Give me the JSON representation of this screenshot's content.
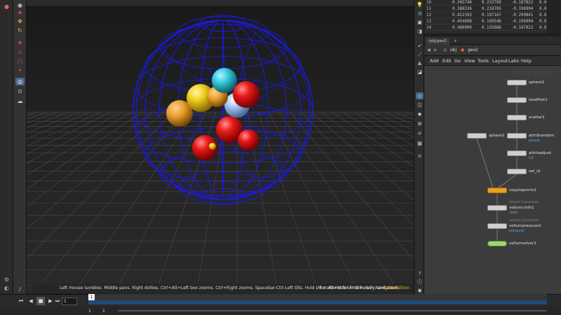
{
  "viewport": {
    "hint_text": "Left mouse tumbles. Middle pans. Right dollies. Ctrl+Alt+Left box zooms. Ctrl+Right zooms. Spacebar-Ctrl-Left tilts. Hold L for alternate tumble, dolly, and zoom.",
    "hint_text_2": "M or Alt+M for First Person Navigation.",
    "edition": "Indie Edition"
  },
  "spreadsheet": {
    "rows": [
      {
        "idx": "10",
        "c1": "0.345744",
        "c2": "0.233789",
        "c3": "-0.187822",
        "c4": "0.0"
      },
      {
        "idx": "11",
        "c1": "0.386326",
        "c2": "0.218785",
        "c3": "-0.196904",
        "c4": "0.0"
      },
      {
        "idx": "12",
        "c1": "0.422393",
        "c2": "0.197167",
        "c3": "-0.200841",
        "c4": "0.0"
      },
      {
        "idx": "13",
        "c1": "0.454098",
        "c2": "0.169546",
        "c3": "-0.196904",
        "c4": "0.0"
      },
      {
        "idx": "14",
        "c1": "0.480900",
        "c2": "0.135686",
        "c3": "-0.187822",
        "c4": "0.0"
      }
    ]
  },
  "network": {
    "tab_label": "/obj/geo2",
    "tab_add": "+",
    "path_obj": "obj",
    "path_geo": "geo2",
    "menu": [
      "Add",
      "Edit",
      "Go",
      "View",
      "Tools",
      "Layout",
      "Labs",
      "Help"
    ],
    "watermark": "Indie Edition",
    "nodes": {
      "sphere1": {
        "label": "sphere1"
      },
      "isooffset1": {
        "label": "isooffset1"
      },
      "scatter1": {
        "label": "scatter1"
      },
      "sphere2": {
        "label": "sphere2"
      },
      "attribrandom": {
        "label": "attribrandom",
        "sub": "pscale"
      },
      "attribadjust": {
        "label": "attribadjust",
        "sub": "Cd"
      },
      "set_id": {
        "label": "set_id"
      },
      "copytopoints1": {
        "label": "copytopoints1"
      },
      "vellumcloth1": {
        "label": "vellumcloth1",
        "top": "Vellum Constraints",
        "sub": "cloth"
      },
      "vellumpressure1": {
        "label": "vellumpressure1",
        "top": "Vellum Constraints",
        "sub": "pressure"
      },
      "vellumsolver1": {
        "label": "vellumsolver1"
      }
    }
  },
  "timeline": {
    "frame": "1",
    "cursor_frame": "1",
    "start": "1",
    "start2": "1"
  },
  "colors": {
    "wire_sphere": "#1a1ae6",
    "grid": "#4a4a4a",
    "ball_yellow": "#f0d020",
    "ball_red": "#e81a1a",
    "ball_orange": "#e8a030",
    "ball_teal": "#30c8d8",
    "ball_blue": "#a0c0f0",
    "timeline_bar": "#1f4a78",
    "node_orange": "#e8a024"
  }
}
